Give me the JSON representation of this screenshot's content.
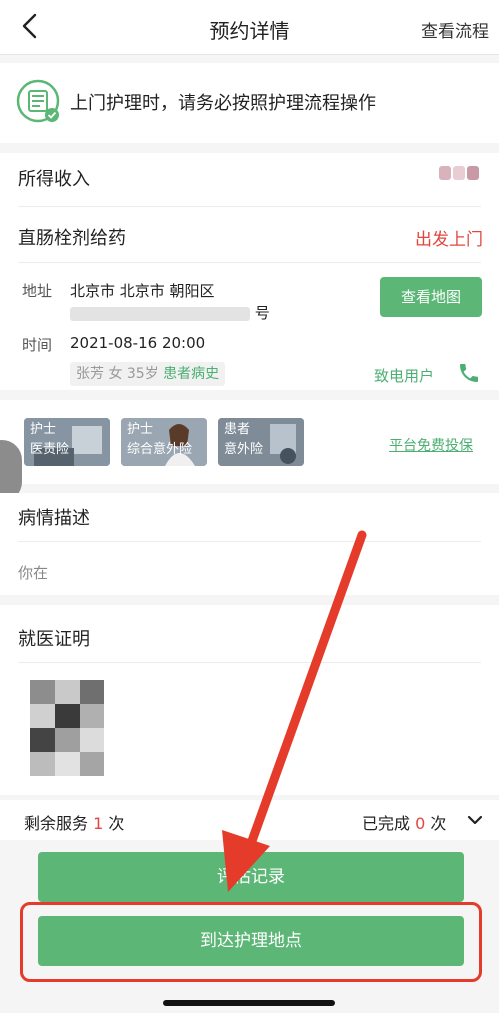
{
  "nav": {
    "title": "预约详情",
    "right": "查看流程",
    "back_icon": "chevron-left-icon"
  },
  "notice": {
    "text": "上门护理时，请务必按照护理流程操作",
    "icon": "document-check-icon"
  },
  "income": {
    "label": "所得收入"
  },
  "service": {
    "name": "直肠栓剂给药",
    "status": "出发上门"
  },
  "address": {
    "label": "地址",
    "line1": "北京市 北京市 朝阳区",
    "line2_suffix": "号",
    "map_button": "查看地图"
  },
  "time": {
    "label": "时间",
    "value": "2021-08-16 20:00"
  },
  "patient": {
    "info": "张芳 女 35岁",
    "history_link": "患者病史",
    "call_label": "致电用户"
  },
  "insurance": {
    "items": [
      {
        "line1": "护士",
        "line2": "医责险"
      },
      {
        "line1": "护士",
        "line2": "综合意外险"
      },
      {
        "line1": "患者",
        "line2": "意外险"
      }
    ],
    "link": "平台免费投保"
  },
  "description": {
    "label": "病情描述",
    "text": "你在"
  },
  "proof": {
    "label": "就医证明"
  },
  "summary": {
    "remain_prefix": "剩余服务",
    "remain_count": "1",
    "remain_unit": "次",
    "done_prefix": "已完成",
    "done_count": "0",
    "done_unit": "次"
  },
  "buttons": {
    "evaluation": "评估记录",
    "arrive": "到达护理地点"
  },
  "colors": {
    "primary": "#5cb777",
    "accent_red": "#e0483f",
    "highlight": "#e53b2b"
  }
}
